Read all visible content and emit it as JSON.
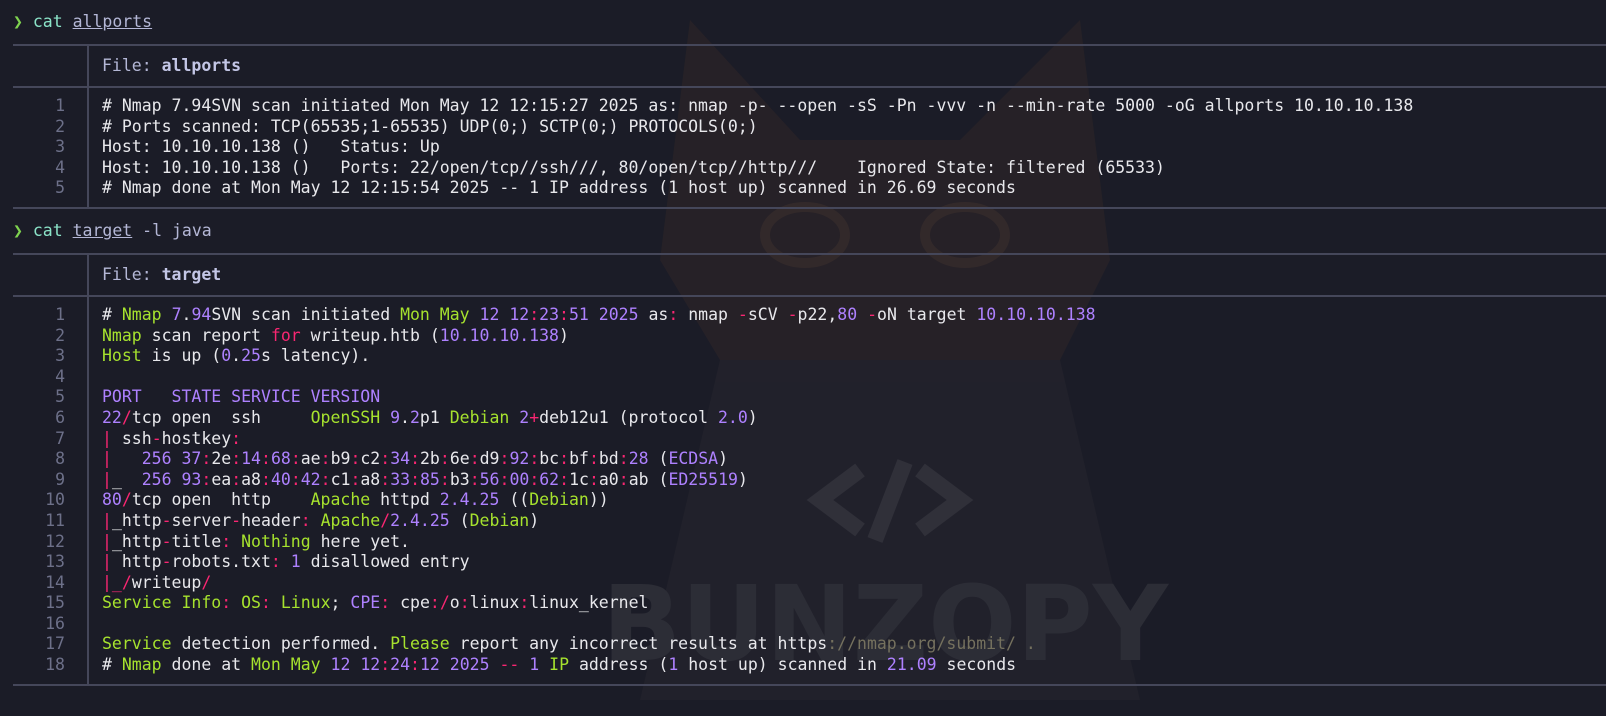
{
  "block1": {
    "prompt_glyph": "❯",
    "cmd": "cat",
    "arg": "allports",
    "file_label": "File: ",
    "file_name": "allports",
    "lines": [
      "# Nmap 7.94SVN scan initiated Mon May 12 12:15:27 2025 as: nmap -p- --open -sS -Pn -vvv -n --min-rate 5000 -oG allports 10.10.10.138",
      "# Ports scanned: TCP(65535;1-65535) UDP(0;) SCTP(0;) PROTOCOLS(0;)",
      "Host: 10.10.10.138 ()   Status: Up",
      "Host: 10.10.10.138 ()   Ports: 22/open/tcp//ssh///, 80/open/tcp//http///    Ignored State: filtered (65533)",
      "# Nmap done at Mon May 12 12:15:54 2025 -- 1 IP address (1 host up) scanned in 26.69 seconds"
    ]
  },
  "block2": {
    "prompt_glyph": "❯",
    "cmd": "cat",
    "arg": "target",
    "flags": " -l java",
    "file_label": "File: ",
    "file_name": "target",
    "lines": [
      [
        [
          "t",
          "# "
        ],
        [
          "k",
          "Nmap"
        ],
        [
          "t",
          " "
        ],
        [
          "n",
          "7"
        ],
        [
          "t",
          "."
        ],
        [
          "n",
          "94"
        ],
        [
          "t",
          "SVN scan initiated "
        ],
        [
          "k",
          "Mon May"
        ],
        [
          "t",
          " "
        ],
        [
          "n",
          "12"
        ],
        [
          "t",
          " "
        ],
        [
          "n",
          "12"
        ],
        [
          "r",
          ":"
        ],
        [
          "n",
          "23"
        ],
        [
          "r",
          ":"
        ],
        [
          "n",
          "51"
        ],
        [
          "t",
          " "
        ],
        [
          "n",
          "2025"
        ],
        [
          "t",
          " as"
        ],
        [
          "r",
          ":"
        ],
        [
          "t",
          " nmap "
        ],
        [
          "r",
          "-"
        ],
        [
          "t",
          "sCV "
        ],
        [
          "r",
          "-"
        ],
        [
          "t",
          "p22,"
        ],
        [
          "n",
          "80"
        ],
        [
          "t",
          " "
        ],
        [
          "r",
          "-"
        ],
        [
          "t",
          "oN target "
        ],
        [
          "n",
          "10.10.10.138"
        ]
      ],
      [
        [
          "k",
          "Nmap"
        ],
        [
          "t",
          " scan report "
        ],
        [
          "r",
          "for"
        ],
        [
          "t",
          " writeup.htb ("
        ],
        [
          "n",
          "10.10.10.138"
        ],
        [
          "t",
          ")"
        ]
      ],
      [
        [
          "k",
          "Host"
        ],
        [
          "t",
          " is up ("
        ],
        [
          "n",
          "0"
        ],
        [
          "t",
          "."
        ],
        [
          "n",
          "25"
        ],
        [
          "t",
          "s latency)."
        ]
      ],
      [
        [
          "t",
          ""
        ]
      ],
      [
        [
          "n",
          "PORT   STATE SERVICE VERSION"
        ]
      ],
      [
        [
          "n",
          "22"
        ],
        [
          "r",
          "/"
        ],
        [
          "t",
          "tcp open  ssh     "
        ],
        [
          "k",
          "OpenSSH"
        ],
        [
          "t",
          " "
        ],
        [
          "n",
          "9"
        ],
        [
          "t",
          "."
        ],
        [
          "n",
          "2"
        ],
        [
          "t",
          "p1 "
        ],
        [
          "k",
          "Debian"
        ],
        [
          "t",
          " "
        ],
        [
          "n",
          "2"
        ],
        [
          "r",
          "+"
        ],
        [
          "t",
          "deb12u1 (protocol "
        ],
        [
          "n",
          "2.0"
        ],
        [
          "t",
          ")"
        ]
      ],
      [
        [
          "r",
          "|"
        ],
        [
          "t",
          " ssh"
        ],
        [
          "r",
          "-"
        ],
        [
          "t",
          "hostkey"
        ],
        [
          "r",
          ":"
        ]
      ],
      [
        [
          "r",
          "|"
        ],
        [
          "t",
          "   "
        ],
        [
          "n",
          "256"
        ],
        [
          "t",
          " "
        ],
        [
          "n",
          "37"
        ],
        [
          "r",
          ":"
        ],
        [
          "t",
          "2e"
        ],
        [
          "r",
          ":"
        ],
        [
          "n",
          "14"
        ],
        [
          "r",
          ":"
        ],
        [
          "n",
          "68"
        ],
        [
          "r",
          ":"
        ],
        [
          "t",
          "ae"
        ],
        [
          "r",
          ":"
        ],
        [
          "t",
          "b9"
        ],
        [
          "r",
          ":"
        ],
        [
          "t",
          "c2"
        ],
        [
          "r",
          ":"
        ],
        [
          "n",
          "34"
        ],
        [
          "r",
          ":"
        ],
        [
          "t",
          "2b"
        ],
        [
          "r",
          ":"
        ],
        [
          "t",
          "6e"
        ],
        [
          "r",
          ":"
        ],
        [
          "t",
          "d9"
        ],
        [
          "r",
          ":"
        ],
        [
          "n",
          "92"
        ],
        [
          "r",
          ":"
        ],
        [
          "t",
          "bc"
        ],
        [
          "r",
          ":"
        ],
        [
          "t",
          "bf"
        ],
        [
          "r",
          ":"
        ],
        [
          "t",
          "bd"
        ],
        [
          "r",
          ":"
        ],
        [
          "n",
          "28"
        ],
        [
          "t",
          " ("
        ],
        [
          "n",
          "ECDSA"
        ],
        [
          "t",
          ")"
        ]
      ],
      [
        [
          "r",
          "|"
        ],
        [
          "t",
          "_  "
        ],
        [
          "n",
          "256"
        ],
        [
          "t",
          " "
        ],
        [
          "n",
          "93"
        ],
        [
          "r",
          ":"
        ],
        [
          "t",
          "ea"
        ],
        [
          "r",
          ":"
        ],
        [
          "t",
          "a8"
        ],
        [
          "r",
          ":"
        ],
        [
          "n",
          "40"
        ],
        [
          "r",
          ":"
        ],
        [
          "n",
          "42"
        ],
        [
          "r",
          ":"
        ],
        [
          "t",
          "c1"
        ],
        [
          "r",
          ":"
        ],
        [
          "t",
          "a8"
        ],
        [
          "r",
          ":"
        ],
        [
          "n",
          "33"
        ],
        [
          "r",
          ":"
        ],
        [
          "n",
          "85"
        ],
        [
          "r",
          ":"
        ],
        [
          "t",
          "b3"
        ],
        [
          "r",
          ":"
        ],
        [
          "n",
          "56"
        ],
        [
          "r",
          ":"
        ],
        [
          "n",
          "00"
        ],
        [
          "r",
          ":"
        ],
        [
          "n",
          "62"
        ],
        [
          "r",
          ":"
        ],
        [
          "t",
          "1c"
        ],
        [
          "r",
          ":"
        ],
        [
          "t",
          "a0"
        ],
        [
          "r",
          ":"
        ],
        [
          "t",
          "ab ("
        ],
        [
          "n",
          "ED25519"
        ],
        [
          "t",
          ")"
        ]
      ],
      [
        [
          "n",
          "80"
        ],
        [
          "r",
          "/"
        ],
        [
          "t",
          "tcp open  http    "
        ],
        [
          "k",
          "Apache"
        ],
        [
          "t",
          " httpd "
        ],
        [
          "n",
          "2.4.25"
        ],
        [
          "t",
          " (("
        ],
        [
          "k",
          "Debian"
        ],
        [
          "t",
          "))"
        ]
      ],
      [
        [
          "r",
          "|"
        ],
        [
          "t",
          "_http"
        ],
        [
          "r",
          "-"
        ],
        [
          "t",
          "server"
        ],
        [
          "r",
          "-"
        ],
        [
          "t",
          "header"
        ],
        [
          "r",
          ":"
        ],
        [
          "t",
          " "
        ],
        [
          "k",
          "Apache"
        ],
        [
          "r",
          "/"
        ],
        [
          "n",
          "2.4.25"
        ],
        [
          "t",
          " ("
        ],
        [
          "k",
          "Debian"
        ],
        [
          "t",
          ")"
        ]
      ],
      [
        [
          "r",
          "|"
        ],
        [
          "t",
          "_http"
        ],
        [
          "r",
          "-"
        ],
        [
          "t",
          "title"
        ],
        [
          "r",
          ":"
        ],
        [
          "t",
          " "
        ],
        [
          "k",
          "Nothing"
        ],
        [
          "t",
          " here yet."
        ]
      ],
      [
        [
          "r",
          "|"
        ],
        [
          "t",
          " http"
        ],
        [
          "r",
          "-"
        ],
        [
          "t",
          "robots.txt"
        ],
        [
          "r",
          ":"
        ],
        [
          "t",
          " "
        ],
        [
          "n",
          "1"
        ],
        [
          "t",
          " disallowed entry"
        ]
      ],
      [
        [
          "r",
          "|_/"
        ],
        [
          "t",
          "writeup"
        ],
        [
          "r",
          "/"
        ]
      ],
      [
        [
          "k",
          "Service Info"
        ],
        [
          "r",
          ":"
        ],
        [
          "t",
          " "
        ],
        [
          "k",
          "OS"
        ],
        [
          "r",
          ":"
        ],
        [
          "t",
          " "
        ],
        [
          "k",
          "Linux"
        ],
        [
          "t",
          "; "
        ],
        [
          "n",
          "CPE"
        ],
        [
          "r",
          ":"
        ],
        [
          "t",
          " cpe"
        ],
        [
          "r",
          ":/"
        ],
        [
          "t",
          "o"
        ],
        [
          "r",
          ":"
        ],
        [
          "t",
          "linux"
        ],
        [
          "r",
          ":"
        ],
        [
          "t",
          "linux_kernel"
        ]
      ],
      [
        [
          "t",
          ""
        ]
      ],
      [
        [
          "k",
          "Service"
        ],
        [
          "t",
          " detection performed. "
        ],
        [
          "k",
          "Please"
        ],
        [
          "t",
          " report any incorrect results at https"
        ],
        [
          "c",
          "://nmap.org/submit/ ."
        ]
      ],
      [
        [
          "t",
          "# "
        ],
        [
          "k",
          "Nmap"
        ],
        [
          "t",
          " done at "
        ],
        [
          "k",
          "Mon May"
        ],
        [
          "t",
          " "
        ],
        [
          "n",
          "12"
        ],
        [
          "t",
          " "
        ],
        [
          "n",
          "12"
        ],
        [
          "r",
          ":"
        ],
        [
          "n",
          "24"
        ],
        [
          "r",
          ":"
        ],
        [
          "n",
          "12"
        ],
        [
          "t",
          " "
        ],
        [
          "n",
          "2025"
        ],
        [
          "t",
          " "
        ],
        [
          "r",
          "--"
        ],
        [
          "t",
          " "
        ],
        [
          "n",
          "1"
        ],
        [
          "t",
          " "
        ],
        [
          "k",
          "IP"
        ],
        [
          "t",
          " address ("
        ],
        [
          "n",
          "1"
        ],
        [
          "t",
          " host up) scanned in "
        ],
        [
          "n",
          "21.09"
        ],
        [
          "t",
          " seconds"
        ]
      ]
    ]
  },
  "watermark": {
    "text": "BUNZOPY",
    "code_glyph": "</>"
  }
}
